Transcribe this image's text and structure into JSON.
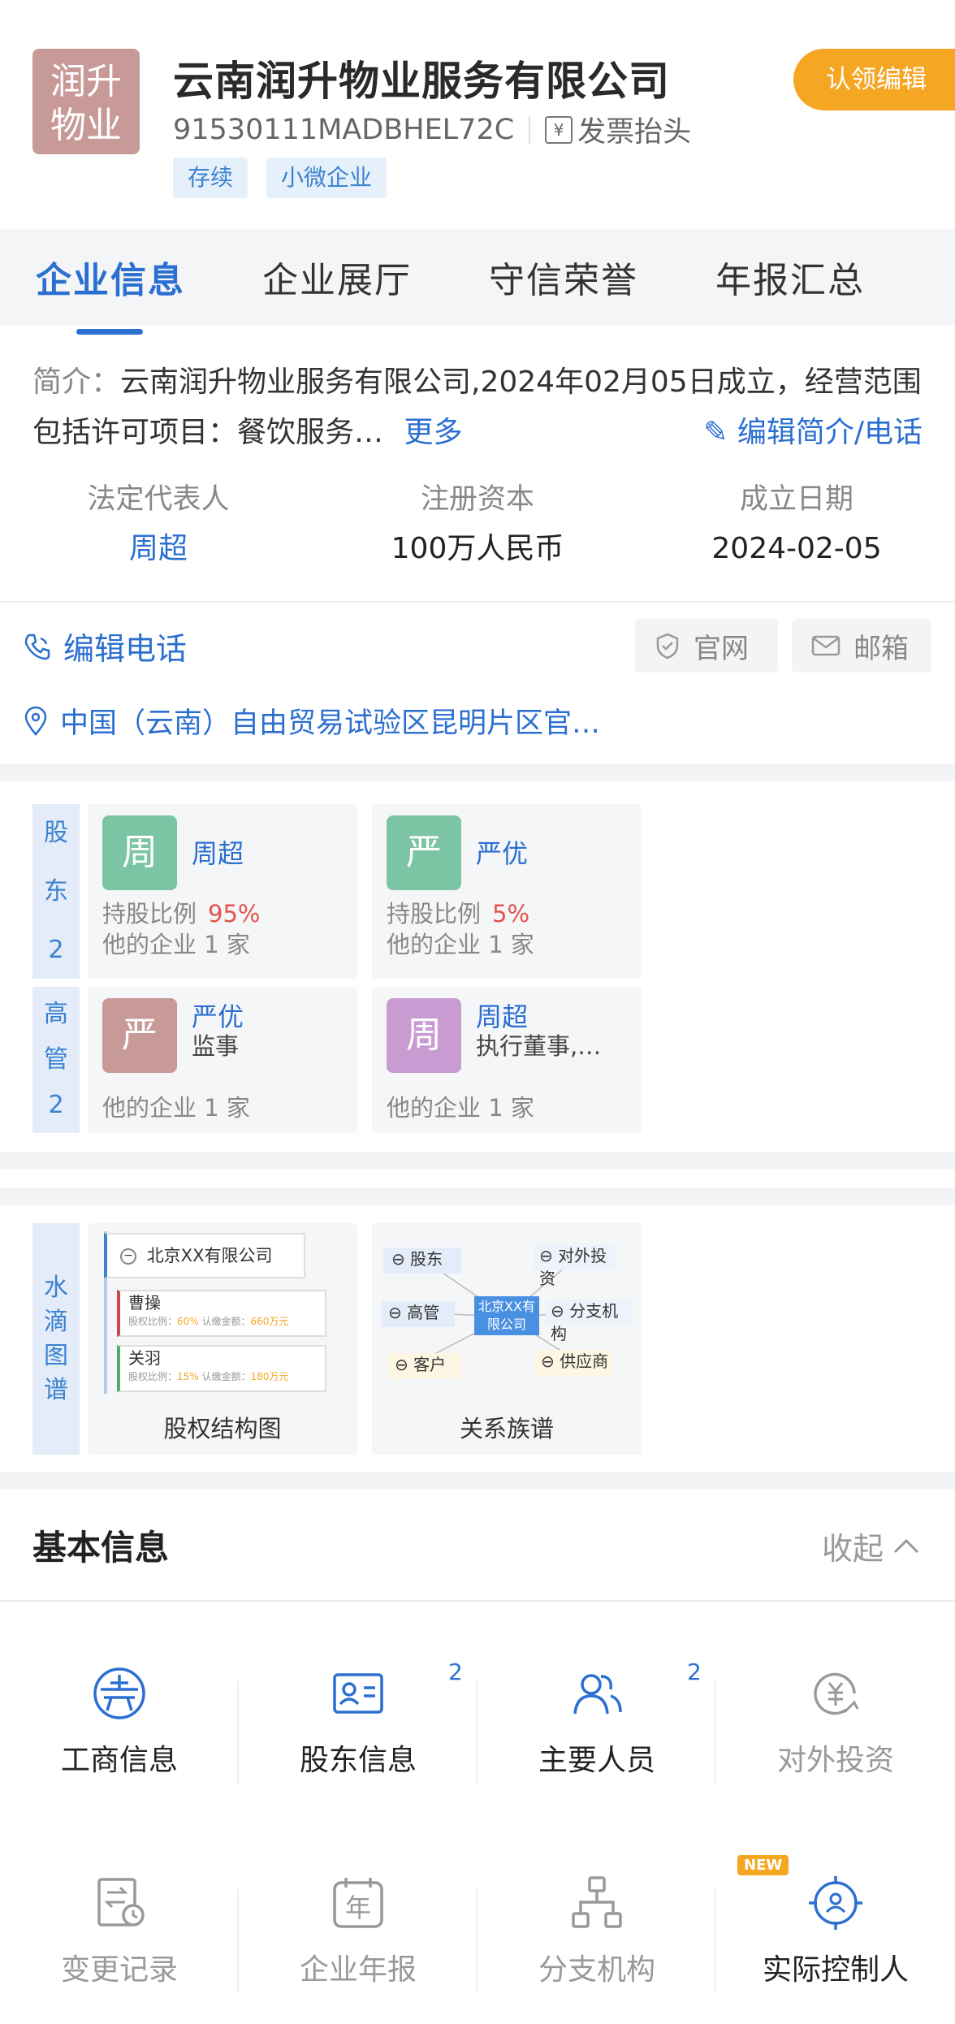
{
  "header": {
    "logo_text": "润升物业",
    "company_name": "云南润升物业服务有限公司",
    "claim_button": "认领编辑",
    "credit_code": "91530111MADBHEL72C",
    "invoice_label": "发票抬头",
    "tags": [
      "存续",
      "小微企业"
    ]
  },
  "tabs": [
    "企业信息",
    "企业展厅",
    "守信荣誉",
    "年报汇总"
  ],
  "intro": {
    "label": "简介：",
    "text": "云南润升物业服务有限公司,2024年02月05日成立，经营范围包括许可项目：餐饮服务…",
    "more": "更多",
    "edit_label": "编辑简介/电话"
  },
  "key_values": [
    {
      "label": "法定代表人",
      "value": "周超"
    },
    {
      "label": "注册资本",
      "value": "100万人民币"
    },
    {
      "label": "成立日期",
      "value": "2024-02-05"
    }
  ],
  "contact": {
    "phone_label": "编辑电话",
    "website_label": "官网",
    "email_label": "邮箱",
    "address": "中国（云南）自由贸易试验区昆明片区官…"
  },
  "shareholders": {
    "label_chars": [
      "股",
      "东",
      "2"
    ],
    "items": [
      {
        "avatar": "周",
        "name": "周超",
        "ratio_label": "持股比例",
        "ratio": "95%",
        "other": "他的企业  1  家",
        "color": "#7cc5a4"
      },
      {
        "avatar": "严",
        "name": "严优",
        "ratio_label": "持股比例",
        "ratio": "5%",
        "other": "他的企业  1  家",
        "color": "#7cc5a4"
      }
    ]
  },
  "executives": {
    "label_chars": [
      "高",
      "管",
      "2"
    ],
    "items": [
      {
        "avatar": "严",
        "name": "严优",
        "role": "监事",
        "other": "他的企业  1  家",
        "color": "#c79a98"
      },
      {
        "avatar": "周",
        "name": "周超",
        "role": "执行董事,…",
        "other": "他的企业  1  家",
        "color": "#c99bd3"
      }
    ]
  },
  "graphs": {
    "label_chars": [
      "水",
      "滴",
      "图",
      "谱"
    ],
    "equity": {
      "caption": "股权结构图",
      "company": "北京XX有限公司",
      "holders": [
        {
          "name": "曹操",
          "ratio": "60%",
          "amount": "660万元"
        },
        {
          "name": "关羽",
          "ratio": "15%",
          "amount": "180万元"
        }
      ],
      "ratio_label": "股权比例：",
      "amount_label": "认缴金额："
    },
    "relation": {
      "caption": "关系族谱",
      "center": "北京XX有限公司",
      "nodes": [
        "股东",
        "对外投资",
        "高管",
        "分支机构",
        "客户",
        "供应商"
      ]
    }
  },
  "basic_info": {
    "title": "基本信息",
    "collapse": "收起",
    "items": [
      {
        "label": "工商信息",
        "icon": "business-info-icon",
        "badge": ""
      },
      {
        "label": "股东信息",
        "icon": "shareholder-card-icon",
        "badge": "2"
      },
      {
        "label": "主要人员",
        "icon": "people-icon",
        "badge": "2"
      },
      {
        "label": "对外投资",
        "icon": "investment-icon",
        "badge": ""
      },
      {
        "label": "变更记录",
        "icon": "change-record-icon",
        "badge": ""
      },
      {
        "label": "企业年报",
        "icon": "annual-report-icon",
        "badge": ""
      },
      {
        "label": "分支机构",
        "icon": "branch-icon",
        "badge": ""
      },
      {
        "label": "实际控制人",
        "icon": "controller-icon",
        "badge": ""
      }
    ],
    "new_tag": "NEW"
  },
  "colors": {
    "accent": "#2b6fd1",
    "claim": "#f5a623",
    "tag_bg": "#e6f0fb"
  }
}
